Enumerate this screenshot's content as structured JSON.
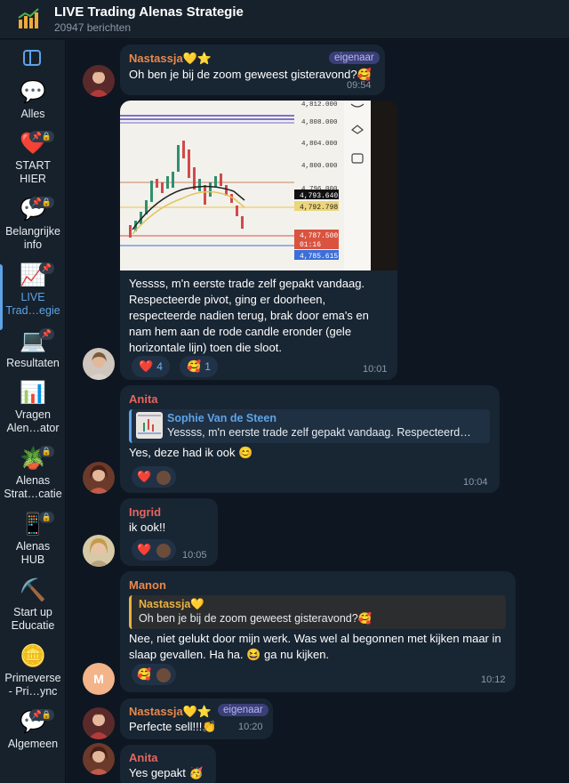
{
  "header": {
    "title": "LIVE Trading Alenas Strategie",
    "subtitle": "20947 berichten",
    "icon": "chart-money-icon"
  },
  "sidebar": {
    "items": [
      {
        "label_lines": [
          "Alles"
        ],
        "icon": "💬"
      },
      {
        "label_lines": [
          "START",
          "HIER"
        ],
        "icon": "❤️"
      },
      {
        "label_lines": [
          "Belangrijke",
          "info"
        ],
        "icon": "💬"
      },
      {
        "label_lines": [
          "LIVE",
          "Trad…egie"
        ],
        "icon": "📈",
        "active": true
      },
      {
        "label_lines": [
          "Resultaten"
        ],
        "icon": "💻"
      },
      {
        "label_lines": [
          "Vragen",
          "Alen…ator"
        ],
        "icon": "📊"
      },
      {
        "label_lines": [
          "Alenas",
          "Strat…catie"
        ],
        "icon": "🪴"
      },
      {
        "label_lines": [
          "Alenas",
          "HUB"
        ],
        "icon": "📱"
      },
      {
        "label_lines": [
          "Start up",
          "Educatie"
        ],
        "icon": "⛏️"
      },
      {
        "label_lines": [
          "Primeverse",
          "- Pri…ync"
        ],
        "icon": "🪙"
      },
      {
        "label_lines": [
          "Algemeen"
        ],
        "icon": "💬"
      }
    ]
  },
  "messages": {
    "m1": {
      "sender": "Nastassja💛⭐",
      "role": "eigenaar",
      "text": "Oh ben je bij de zoom geweest gisteravond?🥰",
      "time": "09:54"
    },
    "m2": {
      "text_lines": [
        "Yessss, m'n eerste trade zelf gepakt vandaag.",
        "Respecteerde pivot, ging er doorheen,",
        "respecteerde nadien terug, brak door ema's en",
        "nam hem aan de rode candle eronder (gele",
        "horizontale lijn) toen die sloot."
      ],
      "time": "10:01",
      "reactions": [
        {
          "emoji": "❤️",
          "count": "4"
        },
        {
          "emoji": "🥰",
          "count": "1"
        }
      ],
      "chart_prices": [
        "4,812.000",
        "4,808.000",
        "4,804.000",
        "4,800.000",
        "4,796.000",
        "4,793.640",
        "4,792.798",
        "4,787.500",
        "01:16",
        "4,785.615"
      ]
    },
    "m3": {
      "sender": "Anita",
      "reply_name": "Sophie Van de Steen",
      "reply_text": "Yessss, m'n eerste trade zelf gepakt vandaag. Respecteerd…",
      "text": "Yes, deze had ik ook 😊",
      "time": "10:04",
      "reaction_emoji": "❤️"
    },
    "m4": {
      "sender": "Ingrid",
      "text": "ik ook!!",
      "time": "10:05",
      "reaction_emoji": "❤️"
    },
    "m5": {
      "sender": "Manon",
      "reply_name": "Nastassja💛",
      "reply_text": "Oh ben je bij de zoom geweest gisteravond?🥰",
      "text_lines": [
        "Nee, niet gelukt door mijn werk. Was wel al begonnen met kijken maar in",
        "slaap gevallen. Ha ha. 😆 ga nu kijken."
      ],
      "time": "10:12",
      "reaction_emoji": "🥰",
      "avatar_letter": "M"
    },
    "m6": {
      "sender": "Nastassja💛⭐",
      "role": "eigenaar",
      "text": "Perfecte sell!!!👏",
      "time": "10:20"
    },
    "m7": {
      "sender": "Anita",
      "text": "Yes gepakt 🥳"
    }
  },
  "colors": {
    "nastassja": "#e8884b",
    "anita": "#e7655f",
    "ingrid": "#e7655f",
    "manon": "#e8884b",
    "sophie": "#5ea3e6",
    "accent": "#5ea3e6"
  }
}
